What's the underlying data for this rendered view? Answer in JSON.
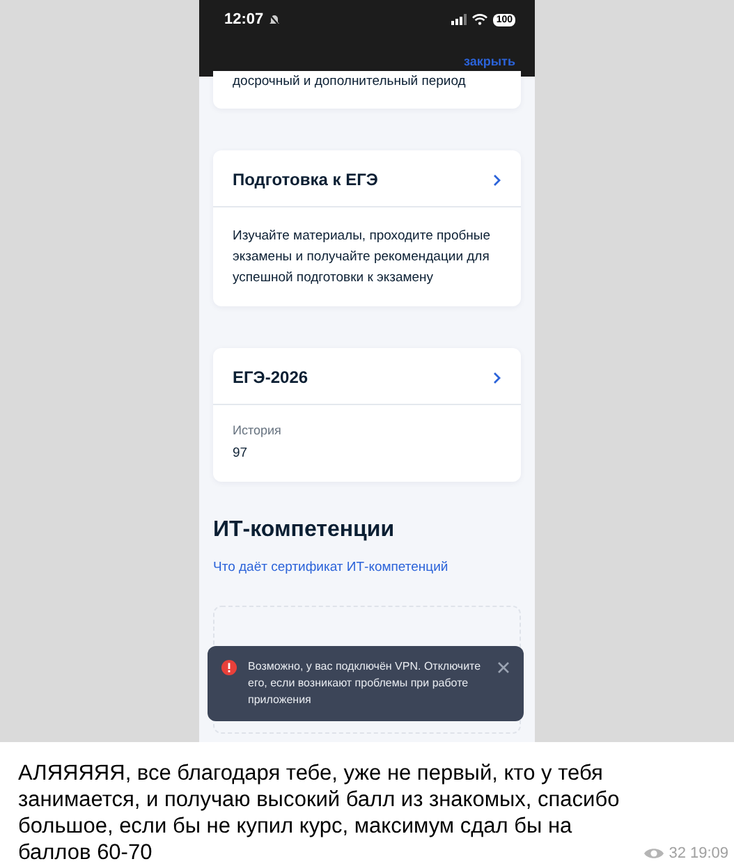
{
  "phone": {
    "status_bar": {
      "time": "12:07",
      "battery": "100"
    },
    "header": {
      "close_link": "закрыть"
    },
    "cards": [
      {
        "kind": "partial",
        "text": "досрочный и дополнительный период"
      },
      {
        "kind": "section",
        "title": "Подготовка к ЕГЭ",
        "body": "Изучайте материалы, проходите пробные экзамены и получайте рекомендации для успешной подготовки к экзамену"
      },
      {
        "kind": "result",
        "title": "ЕГЭ-2026",
        "label": "История",
        "value": "97"
      }
    ],
    "section": {
      "title": "ИТ-компетенции",
      "link": "Что даёт сертификат ИТ-компетенций"
    },
    "toast": {
      "kind": "error",
      "text": "Возможно, у вас подключён VPN. Отключите его, если возникают проблемы при работе приложения"
    }
  },
  "message": {
    "text": "АЛЯЯЯЯЯ, все благодаря тебе, уже не первый, кто у тебя занимается, и получаю высокий балл из знакомых, спасибо большое, если бы не купил курс, максимум сдал бы на баллов 60-70",
    "views": "32",
    "time": "19:09"
  }
}
